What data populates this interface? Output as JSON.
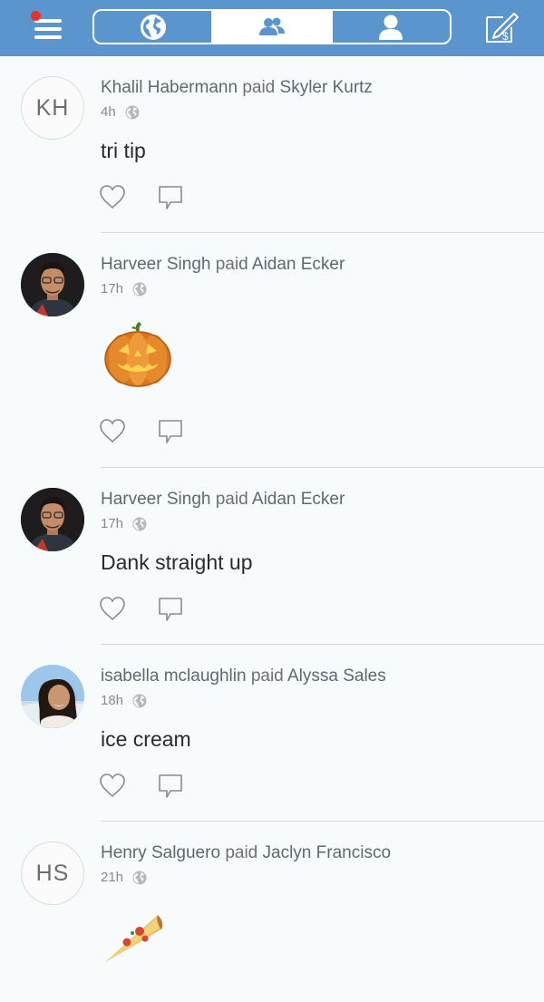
{
  "nav": {
    "menu_icon": "hamburger-menu-icon",
    "notification_color": "#e8322b",
    "tabs": [
      {
        "id": "public",
        "icon": "globe-icon",
        "active": false
      },
      {
        "id": "friends",
        "icon": "friends-icon",
        "active": true
      },
      {
        "id": "mine",
        "icon": "person-icon",
        "active": false
      }
    ],
    "pay_icon": "pay-or-request-icon",
    "bar_color": "#5b95cd"
  },
  "stories": [
    {
      "payer": "Khalil Habermann",
      "verb": "paid",
      "payee": "Skyler Kurtz",
      "time": "4h",
      "avatar_initials": "KH",
      "note": "tri tip",
      "note_kind": "text"
    },
    {
      "payer": "Harveer Singh",
      "verb": "paid",
      "payee": "Aidan Ecker",
      "time": "17h",
      "avatar_photo": "profile-photo-harveer",
      "note_emoji": "jack-o-lantern",
      "note_kind": "emoji"
    },
    {
      "payer": "Harveer Singh",
      "verb": "paid",
      "payee": "Aidan Ecker",
      "time": "17h",
      "avatar_photo": "profile-photo-harveer",
      "note": "Dank straight up",
      "note_kind": "text"
    },
    {
      "payer": "isabella mclaughlin",
      "verb": "paid",
      "payee": "Alyssa Sales",
      "time": "18h",
      "avatar_photo": "profile-photo-isabella",
      "note": "ice cream",
      "note_kind": "text"
    },
    {
      "payer": "Henry Salguero",
      "verb": "paid",
      "payee": "Jaclyn Francisco",
      "time": "21h",
      "avatar_initials": "HS",
      "note_emoji": "pizza",
      "note_kind": "emoji"
    }
  ]
}
